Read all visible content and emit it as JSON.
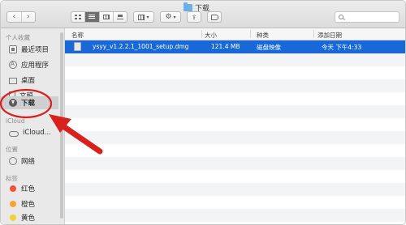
{
  "window": {
    "title": "下载"
  },
  "toolbar": {
    "back_icon": "chevron-left-icon",
    "forward_icon": "chevron-right-icon",
    "views": [
      "icon-view",
      "list-view",
      "column-view",
      "cover-flow-view"
    ],
    "active_view": "list-view"
  },
  "sidebar": {
    "sections": [
      {
        "heading": "个人收藏",
        "items": [
          {
            "label": "最近项目",
            "icon": "recents-icon"
          },
          {
            "label": "应用程序",
            "icon": "applications-icon"
          },
          {
            "label": "桌面",
            "icon": "desktop-icon"
          },
          {
            "label": "文稿",
            "icon": "documents-icon"
          },
          {
            "label": "下载",
            "icon": "downloads-icon",
            "selected": true
          }
        ]
      },
      {
        "heading": "iCloud",
        "items": [
          {
            "label": "iCloud...",
            "icon": "icloud-icon"
          }
        ]
      },
      {
        "heading": "位置",
        "items": [
          {
            "label": "网络",
            "icon": "network-icon"
          }
        ]
      },
      {
        "heading": "标签",
        "items": [
          {
            "label": "红色",
            "color": "#f05138"
          },
          {
            "label": "橙色",
            "color": "#f7a23b"
          },
          {
            "label": "黄色",
            "color": "#f5cf3a"
          }
        ]
      }
    ]
  },
  "columns": {
    "name": "名称",
    "size": "大小",
    "kind": "种类",
    "date_added": "添加日期"
  },
  "files": [
    {
      "name": "ysyy_v1.2.2.1_1001_setup.dmg",
      "size": "121.4 MB",
      "kind": "磁盘映像",
      "date_added": "今天 下午4:33",
      "selected": true
    }
  ],
  "colors": {
    "selection": "#1868d7",
    "annotation": "#d8201c"
  }
}
